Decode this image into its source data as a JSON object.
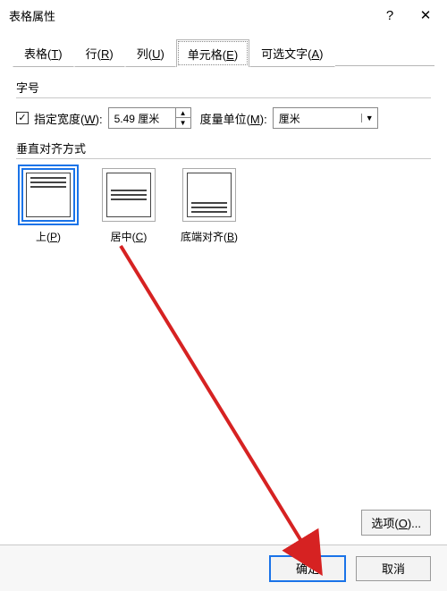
{
  "window": {
    "title": "表格属性",
    "help": "?",
    "close": "✕"
  },
  "tabs": [
    {
      "label": "表格(",
      "accel": "T",
      "suffix": ")"
    },
    {
      "label": "行(",
      "accel": "R",
      "suffix": ")"
    },
    {
      "label": "列(",
      "accel": "U",
      "suffix": ")"
    },
    {
      "label": "单元格(",
      "accel": "E",
      "suffix": ")"
    },
    {
      "label": "可选文字(",
      "accel": "A",
      "suffix": ")"
    }
  ],
  "size": {
    "group": "字号",
    "chk_label": "指定宽度(",
    "chk_accel": "W",
    "chk_suffix": "):",
    "value": "5.49 厘米",
    "unit_label": "度量单位(",
    "unit_accel": "M",
    "unit_suffix": "):",
    "unit_value": "厘米"
  },
  "valign": {
    "group": "垂直对齐方式",
    "opts": [
      {
        "label": "上(",
        "accel": "P",
        "suffix": ")"
      },
      {
        "label": "居中(",
        "accel": "C",
        "suffix": ")"
      },
      {
        "label": "底端对齐(",
        "accel": "B",
        "suffix": ")"
      }
    ]
  },
  "buttons": {
    "options": "选项(",
    "options_accel": "O",
    "options_suffix": ")...",
    "ok": "确定",
    "cancel": "取消"
  }
}
